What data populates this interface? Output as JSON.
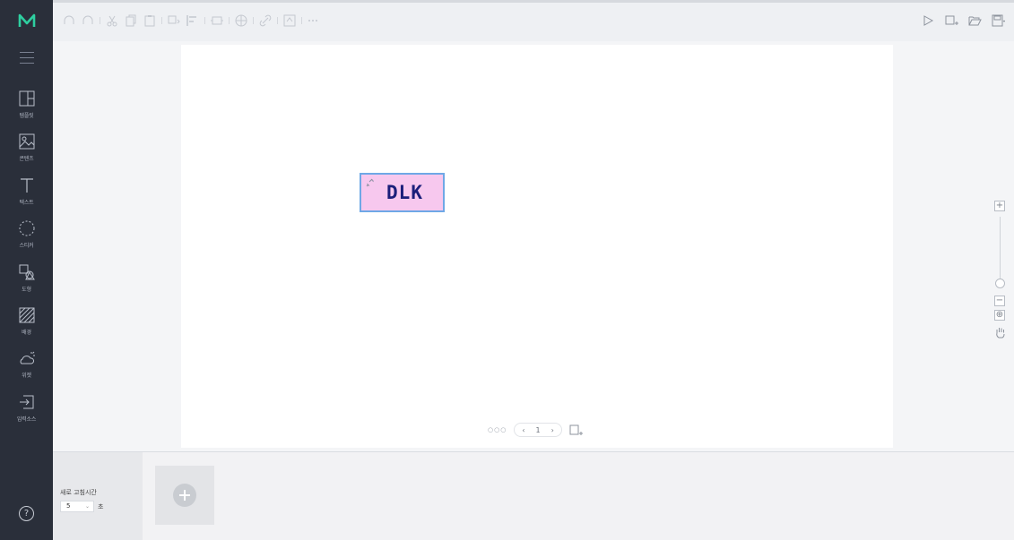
{
  "sidebar": {
    "items": [
      {
        "id": "template",
        "label": "템플릿",
        "icon": "template-icon"
      },
      {
        "id": "contents",
        "label": "콘텐츠",
        "icon": "image-icon"
      },
      {
        "id": "text",
        "label": "텍스트",
        "icon": "text-icon"
      },
      {
        "id": "sticker",
        "label": "스티커",
        "icon": "sticker-icon"
      },
      {
        "id": "shape",
        "label": "도형",
        "icon": "shape-icon"
      },
      {
        "id": "background",
        "label": "배경",
        "icon": "background-icon"
      },
      {
        "id": "widget",
        "label": "위젯",
        "icon": "weather-icon"
      },
      {
        "id": "input-source",
        "label": "입력소스",
        "icon": "input-source-icon"
      }
    ],
    "help": "?"
  },
  "canvas": {
    "text_element": "DLK",
    "page_number": "1",
    "prev": "‹",
    "next": "›",
    "dots": "○○○"
  },
  "zoom": {
    "in": "+",
    "out": "−",
    "fit": "⊕",
    "level": 0.05
  },
  "bottom": {
    "duration_label": "새로 고침시간",
    "duration_value": "5",
    "duration_unit": "초"
  },
  "colors": {
    "sidebar": "#2a2f3a",
    "logo_accent": "#2ecfa0",
    "text_fill": "#f7c8ee",
    "text_color": "#1b1f7a",
    "selection": "#6fa8e6"
  }
}
